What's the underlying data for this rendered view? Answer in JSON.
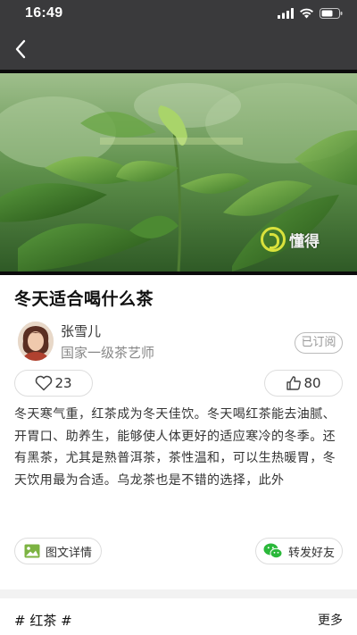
{
  "status_bar": {
    "time": "16:49",
    "icons": [
      "signal-icon",
      "wifi-icon",
      "battery-icon"
    ]
  },
  "nav": {
    "back_icon": "chevron-left-icon"
  },
  "video": {
    "watermark_text": "懂得",
    "logo_color": "#d9e23c"
  },
  "article": {
    "title": "冬天适合喝什么茶",
    "author": {
      "name": "张雪儿",
      "title": "国家一级茶艺师",
      "subscribe_label": "已订阅"
    },
    "likes": "23",
    "thumbs_up": "80",
    "body": "冬天寒气重，红茶成为冬天佳饮。冬天喝红茶能去油腻、开胃口、助养生，能够使人体更好的适应寒冷的冬季。还有黑茶，尤其是熟普洱茶，茶性温和，可以生热暖胃，冬天饮用最为合适。乌龙茶也是不错的选择，此外",
    "detail_label": "图文详情",
    "share_label": "转发好友"
  },
  "tags": {
    "tag_label": "# 红茶 #",
    "more_label": "更多"
  },
  "colors": {
    "header_bg": "#3a3a3c",
    "wechat_green": "#2ab83a",
    "image_icon_green": "#7cb342"
  }
}
